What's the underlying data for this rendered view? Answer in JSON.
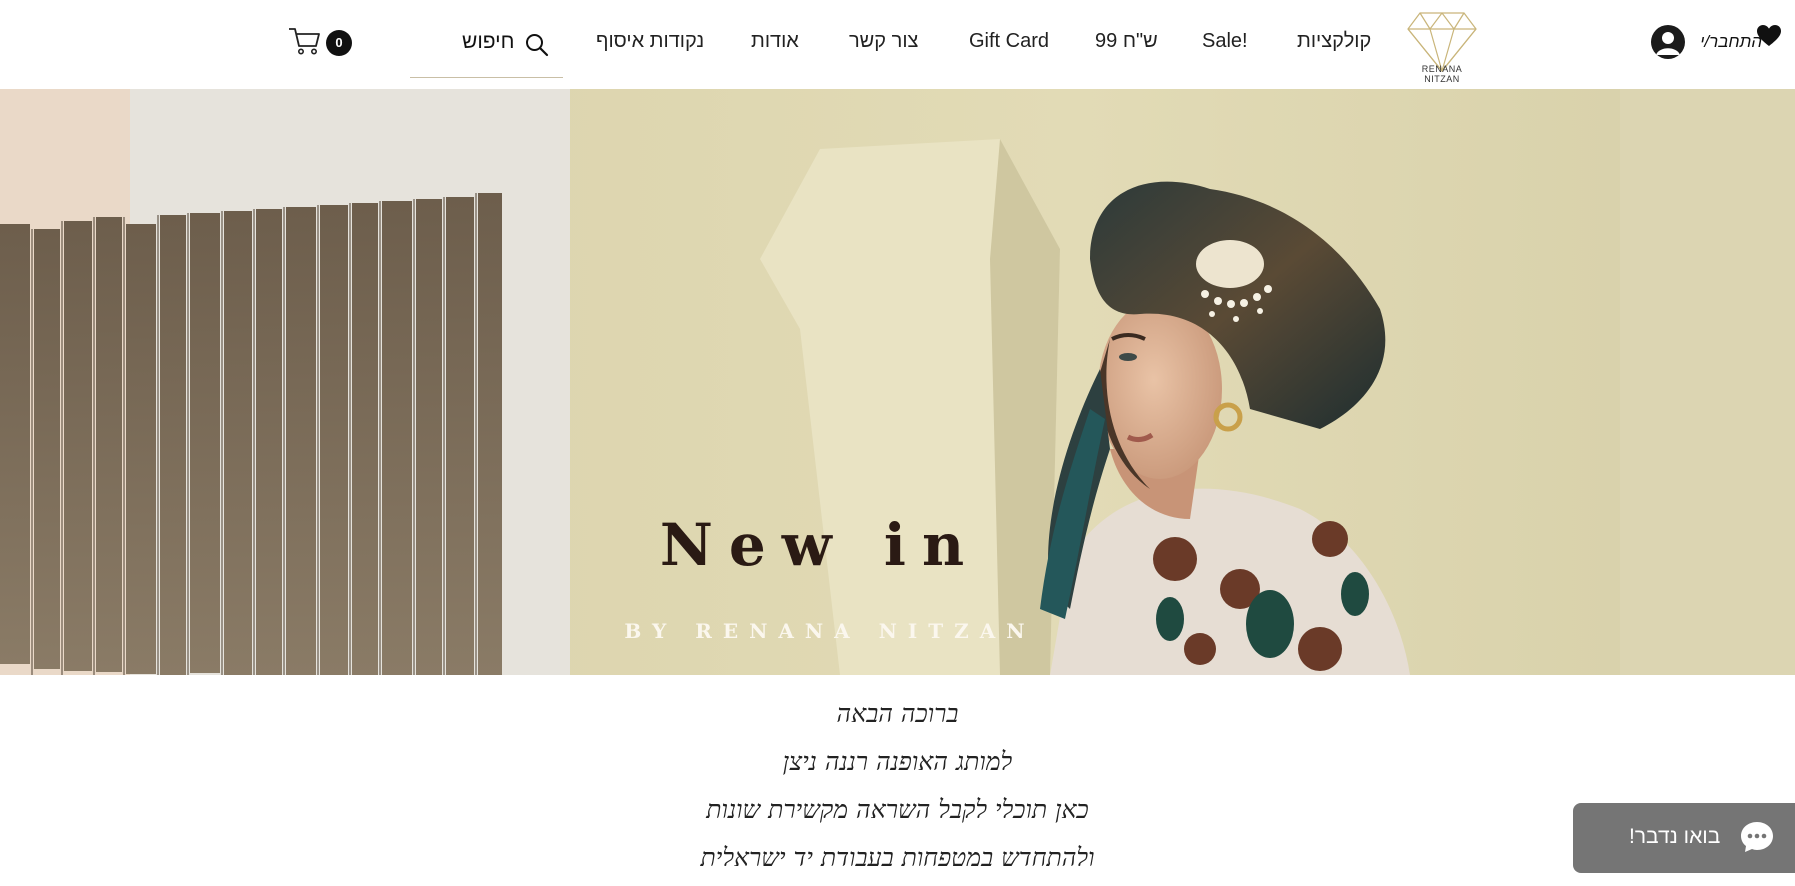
{
  "header": {
    "cart_count": "0",
    "search_label": "חיפוש",
    "nav": [
      "נקודות איסוף",
      "אודות",
      "צור קשר",
      "Gift Card",
      "99 ש\"ח",
      "Sale!",
      "קולקציות"
    ],
    "logo_text": "RENANA NITZAN",
    "login_label": "התחבר/י"
  },
  "hero": {
    "title": "New in",
    "subtitle": "BY RENANA NITZAN"
  },
  "welcome": {
    "lines": [
      "ברוכה הבאה",
      "למותג האופנה רננה ניצן",
      "כאן תוכלי לקבל השראה מקשירת שונות",
      "ולהתחדש במטפחות בעבודת יד ישראלית"
    ]
  },
  "chat": {
    "label": "בואו נדבר!"
  },
  "colors": {
    "accent_gold": "#c9b57a",
    "chat_bg": "#757575",
    "hero_title": "#2a1a14"
  },
  "icons": [
    "cart-icon",
    "search-icon",
    "diamond-logo-icon",
    "avatar-icon",
    "heart-icon",
    "chat-bubble-icon"
  ]
}
